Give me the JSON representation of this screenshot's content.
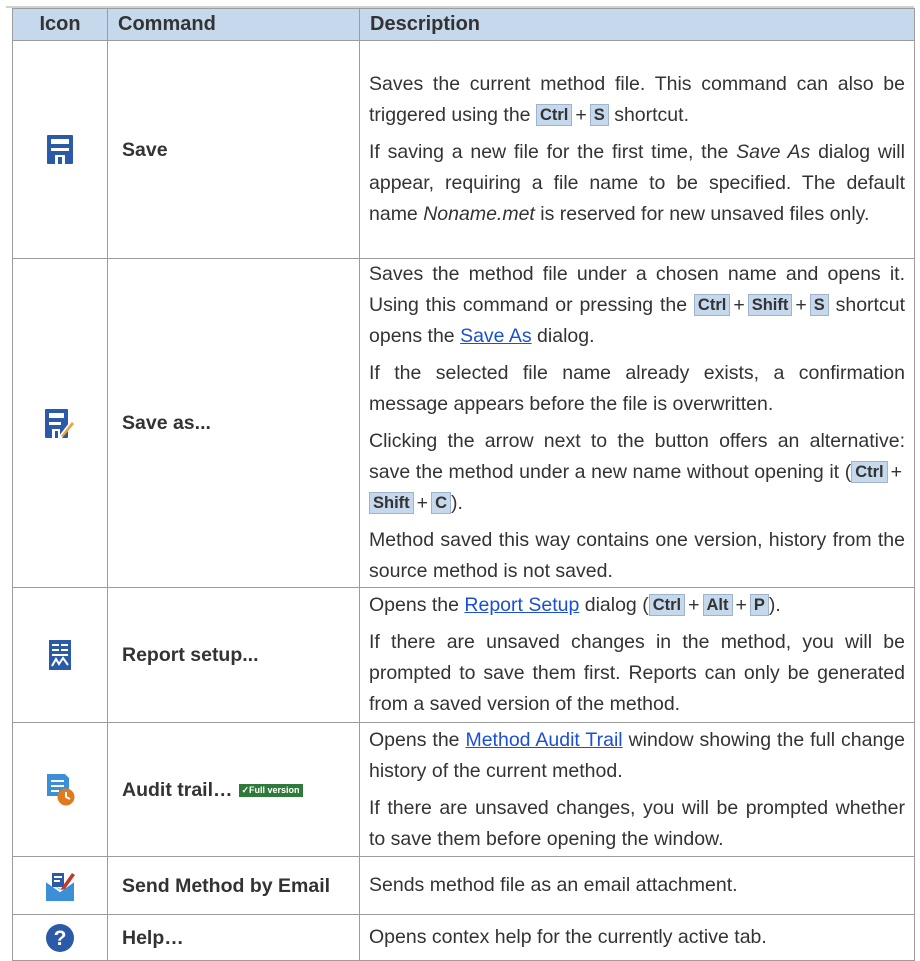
{
  "headers": {
    "icon": "Icon",
    "command": "Command",
    "description": "Description"
  },
  "rows": [
    {
      "icon": "save-icon",
      "command": "Save",
      "p1a": "Saves the current method file. This command can also be triggered using the ",
      "p1k1": "Ctrl",
      "p1k2": "S",
      "p1b": " shortcut.",
      "p2a": "If saving a new file for the first time, the ",
      "p2i1": "Save As",
      "p2b": " dialog will appear, requiring a file name to be specified. The default name ",
      "p2i2": "Noname.met",
      "p2c": " is reserved for new unsaved files only."
    },
    {
      "icon": "save-as-icon",
      "command": "Save as...",
      "p1a": "Saves the method file under a chosen name and opens it. Using this command or pressing the ",
      "p1k1": "Ctrl",
      "p1k2": "Shift",
      "p1k3": "S",
      "p1b": " shortcut opens the ",
      "p1link": "Save As",
      "p1c": " dialog.",
      "p2": "If the selected file name already exists, a confirmation message appears before the file is overwritten.",
      "p3a": "Clicking the arrow next to the button offers an alternative: save the method under a new name without opening it (",
      "p3k1": "Ctrl",
      "p3k2": "Shift",
      "p3k3": "C",
      "p3b": ").",
      "p4": "Method saved this way contains one version, history from the source method is not saved."
    },
    {
      "icon": "report-setup-icon",
      "command": "Report setup...",
      "p1a": "Opens the ",
      "p1link": "Report Setup",
      "p1b": " dialog (",
      "p1k1": "Ctrl",
      "p1k2": "Alt",
      "p1k3": "P",
      "p1c": ").",
      "p2": "If there are unsaved changes in the method, you will be prompted to save them first. Reports can only be generated from a saved version of the method."
    },
    {
      "icon": "audit-trail-icon",
      "command": "Audit trail…",
      "badge": "✓Full version",
      "p1a": "Opens the ",
      "p1link": "Method Audit Trail",
      "p1b": " window showing the full change history of the current method.",
      "p2": "If there are unsaved changes, you will be prompted whether to save them before opening the window."
    },
    {
      "icon": "send-email-icon",
      "command": "Send Method by Email",
      "p1": "Sends method file as an email attachment."
    },
    {
      "icon": "help-icon",
      "command": "Help…",
      "p1": "Opens contex help for the currently active tab."
    }
  ],
  "plus": "+",
  "colors": {
    "header_bg": "#c5d8ec",
    "icon_blue": "#2a5aa8",
    "link": "#1b4fd6",
    "badge_green": "#2f7a3a",
    "clock_orange": "#e07a1f"
  }
}
